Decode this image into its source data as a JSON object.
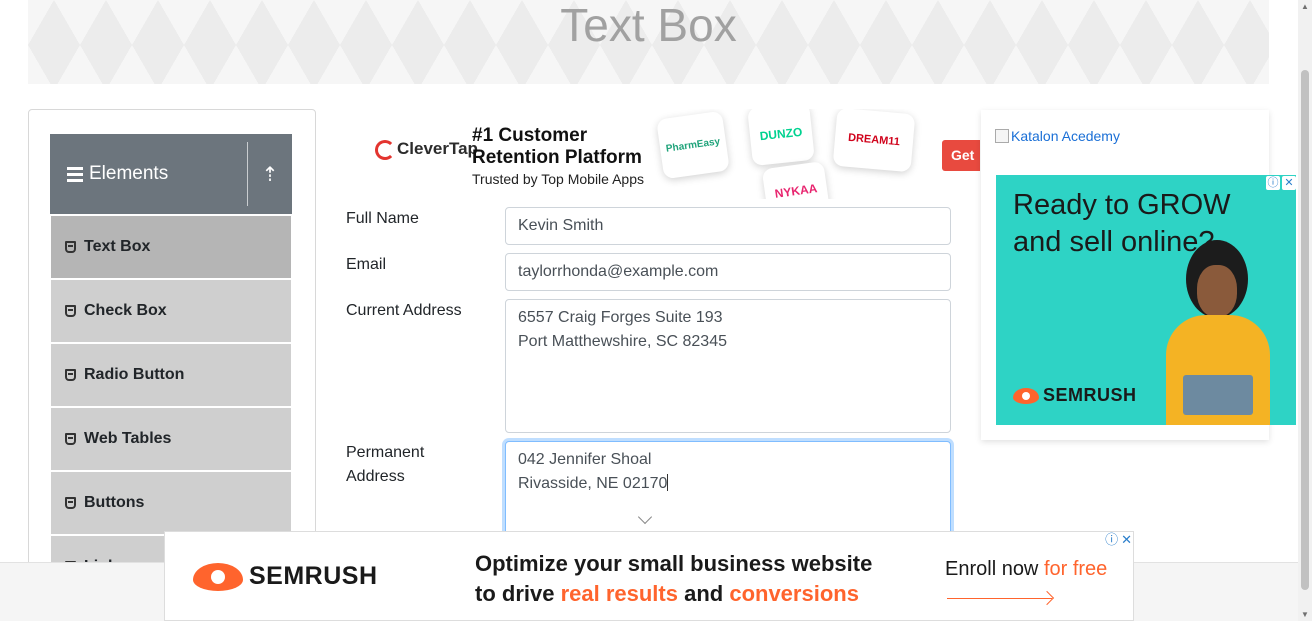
{
  "header": {
    "title": "Text Box"
  },
  "sidebar": {
    "group_title": "Elements",
    "items": [
      {
        "label": "Text Box",
        "active": true
      },
      {
        "label": "Check Box"
      },
      {
        "label": "Radio Button"
      },
      {
        "label": "Web Tables"
      },
      {
        "label": "Buttons"
      },
      {
        "label": "Links"
      }
    ]
  },
  "ad_top": {
    "brand": "CleverTap",
    "headline_1": "#1 Customer",
    "headline_2": "Retention Platform",
    "subline": "Trusted by Top Mobile Apps",
    "cards": [
      "PharmEasy",
      "DUNZO",
      "DREAM11",
      "NYKAA"
    ],
    "cta": "Get"
  },
  "form": {
    "full_name": {
      "label": "Full Name",
      "value": "Kevin Smith"
    },
    "email": {
      "label": "Email",
      "value": "taylorrhonda@example.com"
    },
    "current_address": {
      "label": "Current Address",
      "line1": "6557 Craig Forges Suite 193",
      "line2": "Port Matthewshire, SC 82345"
    },
    "permanent_address": {
      "label_1": "Permanent",
      "label_2": "Address",
      "line1": "042 Jennifer Shoal",
      "line2": "Rivasside, NE 02170"
    }
  },
  "ad_right": {
    "image_alt": "Katalon Acedemy",
    "headline_1": "Ready to GROW",
    "headline_2": "and sell online?",
    "brand": "SEMRUSH"
  },
  "ad_bottom": {
    "brand": "SEMRUSH",
    "headline_1": "Optimize your small business website",
    "headline_2_a": "to drive ",
    "headline_2_b": "real results",
    "headline_2_c": " and ",
    "headline_2_d": "conversions",
    "cta_a": "Enroll now ",
    "cta_b": "for free"
  },
  "colors": {
    "accent": "#ff642d",
    "sidebar_header": "#6c757d",
    "focus": "#80bdff",
    "teal": "#2ed3c5"
  }
}
